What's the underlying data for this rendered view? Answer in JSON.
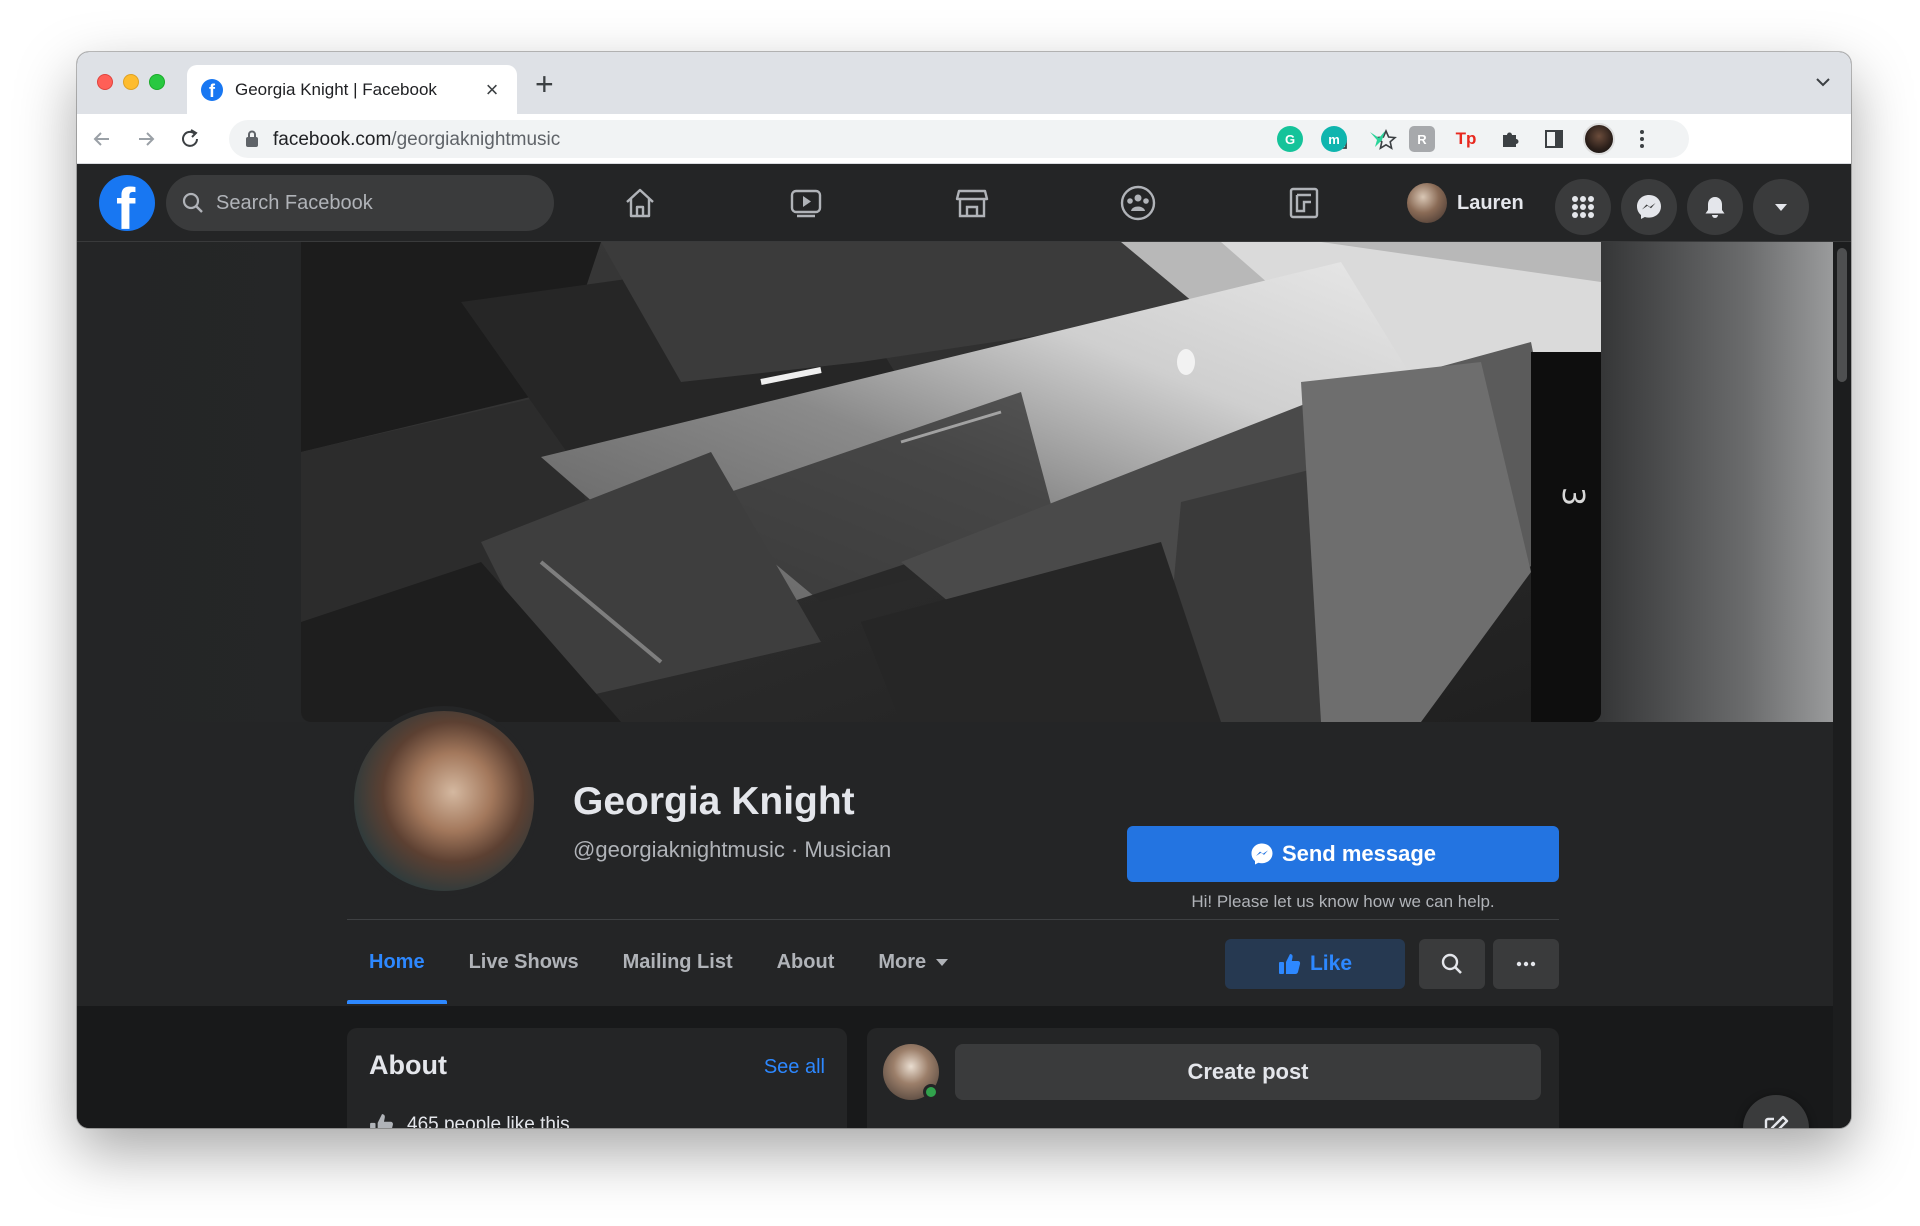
{
  "browser": {
    "tab_title": "Georgia Knight | Facebook",
    "url_domain": "facebook.com",
    "url_path": "/georgiaknightmusic",
    "extensions": [
      "grammarly-icon",
      "m-icon",
      "bird-icon",
      "r-icon",
      "tp-icon",
      "puzzle-icon",
      "sidepanel-icon"
    ],
    "ext_labels": {
      "m": "m",
      "r": "R",
      "tp": "Tp"
    }
  },
  "fb_nav": {
    "search_placeholder": "Search Facebook",
    "profile_name": "Lauren"
  },
  "profile": {
    "name": "Georgia Knight",
    "subtitle": "@georgiaknightmusic · Musician",
    "send_message_label": "Send message",
    "send_hint": "Hi! Please let us know how we can help."
  },
  "page_tabs": [
    "Home",
    "Live Shows",
    "Mailing List",
    "About",
    "More"
  ],
  "actions": {
    "like_label": "Like",
    "more_label": "···"
  },
  "about_card": {
    "title": "About",
    "see_all": "See all",
    "likes_text": "465 people like this"
  },
  "post_card": {
    "create_post": "Create post"
  },
  "colors": {
    "fb_blue": "#1877f2",
    "button_blue": "#2374e1",
    "link_blue": "#2d88ff",
    "dark_bg": "#18191a",
    "surface": "#242526"
  }
}
